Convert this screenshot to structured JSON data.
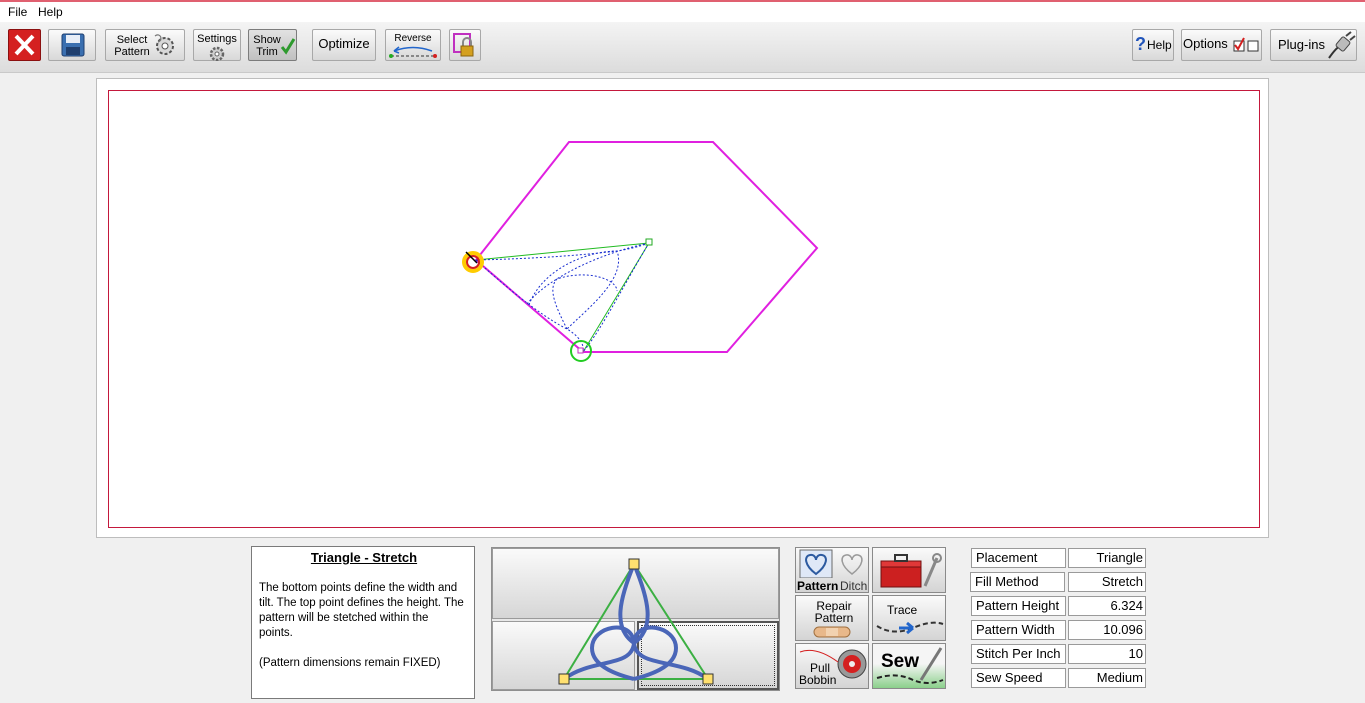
{
  "menu": {
    "file": "File",
    "help": "Help"
  },
  "toolbar": {
    "select_pattern_line1": "Select",
    "select_pattern_line2": "Pattern",
    "settings": "Settings",
    "show_trim_line1": "Show",
    "show_trim_line2": "Trim",
    "optimize": "Optimize",
    "reverse": "Reverse",
    "help": "Help",
    "options": "Options",
    "plugins": "Plug-ins"
  },
  "description": {
    "title": "Triangle - Stretch",
    "body": "The bottom points define the width and tilt. The top point defines the height. The pattern will be stetched within the points.",
    "note": "(Pattern dimensions remain FIXED)"
  },
  "actions": {
    "pattern": "Pattern",
    "ditch": "Ditch",
    "repair_line1": "Repair",
    "repair_line2": "Pattern",
    "trace": "Trace",
    "pull_line1": "Pull",
    "pull_line2": "Bobbin",
    "sew": "Sew"
  },
  "properties": [
    {
      "label": "Placement",
      "value": "Triangle"
    },
    {
      "label": "Fill Method",
      "value": "Stretch"
    },
    {
      "label": "Pattern Height",
      "value": "6.324"
    },
    {
      "label": "Pattern Width",
      "value": "10.096"
    },
    {
      "label": "Stitch Per Inch",
      "value": "10"
    },
    {
      "label": "Sew Speed",
      "value": "Medium"
    }
  ],
  "colors": {
    "shape_outline": "#e020e0",
    "guide_line": "#22bb22",
    "stitch_path": "#1a2fd0",
    "canvas_border": "#c4183c",
    "close_red": "#d42020"
  }
}
